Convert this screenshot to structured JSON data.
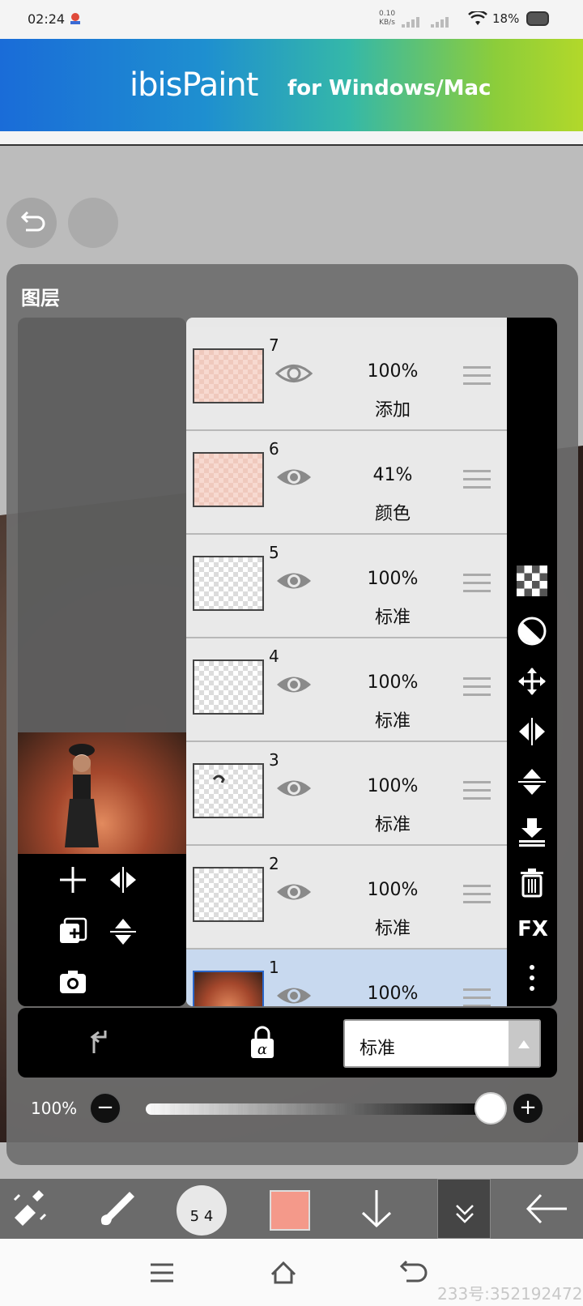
{
  "status_bar": {
    "time": "02:24",
    "net_speed_value": "0.10",
    "net_speed_unit": "KB/s",
    "battery": "18%"
  },
  "banner": {
    "logo": "ibisPaint",
    "tagline": "for Windows/Mac",
    "colors": [
      "#1a6cd8",
      "#35b8a8",
      "#b2d82a"
    ]
  },
  "panel": {
    "title": "图层"
  },
  "layers": [
    {
      "number": "7",
      "opacity": "100%",
      "blend": "添加",
      "thumb": "pink"
    },
    {
      "number": "6",
      "opacity": "41%",
      "blend": "颜色",
      "thumb": "pink"
    },
    {
      "number": "5",
      "opacity": "100%",
      "blend": "标准",
      "thumb": "empty"
    },
    {
      "number": "4",
      "opacity": "100%",
      "blend": "标准",
      "thumb": "empty"
    },
    {
      "number": "3",
      "opacity": "100%",
      "blend": "标准",
      "thumb": "sketch"
    },
    {
      "number": "2",
      "opacity": "100%",
      "blend": "标准",
      "thumb": "empty"
    },
    {
      "number": "1",
      "opacity": "100%",
      "blend": "",
      "thumb": "photo",
      "selected": true
    }
  ],
  "right_tools": [
    "checker-icon",
    "contrast-icon",
    "move-icon",
    "flip-horizontal-icon",
    "flip-vertical-icon",
    "merge-down-icon",
    "trash-icon",
    "FX",
    "more-icon"
  ],
  "blend_bar": {
    "mode": "标准"
  },
  "opacity_slider": {
    "label": "100%",
    "minus": "−",
    "plus": "+",
    "value": 1.0
  },
  "toolbar": {
    "brush_size": "5 4",
    "color": "#f4998a"
  },
  "watermark": "233号:352192472"
}
